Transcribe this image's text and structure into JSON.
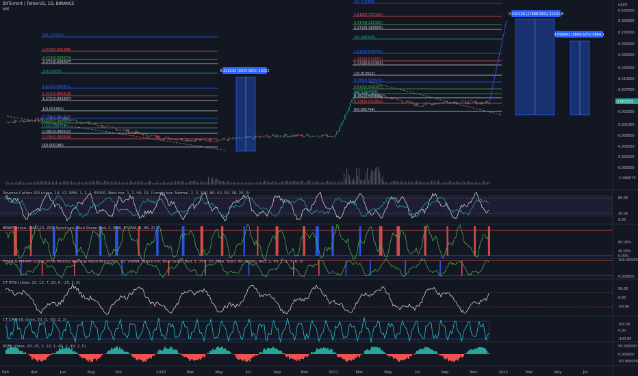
{
  "header": {
    "symbol": "BitTorrent / TetherUS, 1D, BINANCE",
    "vol": "Vol"
  },
  "colors": {
    "bg": "#131722",
    "up": "#26a69a",
    "down": "#ef5350",
    "fibBlue": "#2962ff",
    "grid": "#2a2e39",
    "axisText": "#b2b5be",
    "white": "#d1d4dc"
  },
  "price_axis": {
    "unit": "USDT",
    "ticks": [
      "0.550000",
      "0.300000",
      "0.150000",
      "0.090000",
      "0.050000",
      "0.025000",
      "0.013000",
      "0.007000",
      "0.004000",
      "0.002000",
      "0.001000",
      "0.000500",
      "0.000250",
      "0.000100",
      "0.000000",
      "-0.000070"
    ],
    "current_price": "0.003523"
  },
  "time_axis": [
    "Feb",
    "Apr",
    "Jun",
    "Aug",
    "Oct",
    "2020",
    "Mar",
    "May",
    "Jul",
    "Sep",
    "Nov",
    "2021",
    "Mar",
    "May",
    "Jul",
    "Sep",
    "Nov",
    "2022",
    "Mar",
    "May",
    "Jul"
  ],
  "fib_left": [
    {
      "label": "3(0.113421)",
      "color": "#2962ff"
    },
    {
      "label": "2.618(0.052396)",
      "color": "#ef5350"
    },
    {
      "label": "2.414(0.034674)",
      "color": "#4caf50"
    },
    {
      "label": "2.272(0.026007)",
      "color": "#d1d4dc"
    },
    {
      "label": "2(0.01975)",
      "color": "#26a69a"
    },
    {
      "label": "1.618(0.006471)",
      "color": "#2962ff"
    },
    {
      "label": "1.414(0.004518)",
      "color": "#ef5350"
    },
    {
      "label": "1.272(0.003367)",
      "color": "#d1d4dc"
    },
    {
      "label": "1(0.001902)",
      "color": "#d1d4dc"
    },
    {
      "label": "0.786(0.001303)",
      "color": "#2962ff"
    },
    {
      "label": "0.618(0.000932)",
      "color": "#4caf50"
    },
    {
      "label": "0.5(0.000711)",
      "color": "#26a69a"
    },
    {
      "label": "0.382(0.000532)",
      "color": "#d1d4dc"
    },
    {
      "label": "0.236(0.000328)",
      "color": "#ef5350"
    },
    {
      "label": "0(0.000166)",
      "color": "#d1d4dc"
    }
  ],
  "fib_right": [
    {
      "label": "3(0.718399)",
      "color": "#2962ff"
    },
    {
      "label": "2.618(0.337193)",
      "color": "#ef5350"
    },
    {
      "label": "2.414(0.225150)",
      "color": "#4caf50"
    },
    {
      "label": "2.272(0.169956)",
      "color": "#d1d4dc"
    },
    {
      "label": "2(0.099158)",
      "color": "#26a69a"
    },
    {
      "label": "1.618(0.046499)",
      "color": "#2962ff"
    },
    {
      "label": "1.414(0.031097)",
      "color": "#ef5350"
    },
    {
      "label": "1.272(0.023393)",
      "color": "#d1d4dc"
    },
    {
      "label": "1(0.013612)",
      "color": "#d1d4dc"
    },
    {
      "label": "0.786(0.008916)",
      "color": "#2962ff"
    },
    {
      "label": "0.618(0.006387)",
      "color": "#4caf50"
    },
    {
      "label": "0.5(0.004966)",
      "color": "#26a69a"
    },
    {
      "label": "0.382(0.003835)",
      "color": "#d1d4dc"
    },
    {
      "label": "0.236(0.002902)",
      "color": "#ef5350"
    },
    {
      "label": "0(0.001794)",
      "color": "#d1d4dc"
    }
  ],
  "measure_boxes": [
    {
      "label": "0.212232 (8215.61%) 13212"
    },
    {
      "label": "0.315218 (17908.56%) 31521.8"
    },
    {
      "label": "0.098641 (5604.62%) 9864.1"
    }
  ],
  "panels": [
    {
      "label": "Reverse Cutlers RSI (close, 14, 12, SMA, 1, 2, 1, 65000, Next bar, 1, 1, 90, 15, Current bar, Normal, 2, 3, 100, 80, 62, 50, 38, 20, 0)",
      "ticks": [
        "80.00",
        "20.00",
        "0.00"
      ]
    },
    {
      "label": "BBWP (close, SMA, 13, 252, Spectrum, Blue Green Red, 2, SMA, 5, SMA, 8, 98, 2)",
      "ticks": [
        "80.00%",
        "40.00%",
        "0.00%"
      ]
    },
    {
      "label": "PMAR & PMARP (close, Price Moving Average Ratio Percentile, 20, VWMA, Spectrum, Blue Green Red, 1, 350, 20, SMA, Solid, 80, Green, Red, 1, 99, 1, 2, 7, 6, 5)",
      "ticks": [
        "100.000000",
        "0.000000"
      ]
    },
    {
      "label": "CT RTSI (close, 25, 13, 7, 25, 0, -25, 2, 6)",
      "ticks": [
        "50.00",
        "0.00",
        "-50.00"
      ]
    },
    {
      "label": "CT CMO (9, close, 50, 0, -50, 2, 3)",
      "ticks": [
        "100.00",
        "0.00",
        "-100.00"
      ]
    },
    {
      "label": "RSMI (close, 13, 25, 2, 12, 1, 40, 2, 40, 2, 5)",
      "ticks": [
        "50.000000",
        "0.000000",
        "-50.000000"
      ]
    }
  ],
  "chart_data": {
    "type": "line",
    "title": "BitTorrent / TetherUS, 1D, BINANCE",
    "y_scale": "log",
    "ylabel": "USDT",
    "x": [
      "2019-02",
      "2019-04",
      "2019-06",
      "2019-08",
      "2019-10",
      "2020-01",
      "2020-03",
      "2020-05",
      "2020-07",
      "2020-09",
      "2020-11",
      "2021-01",
      "2021-03",
      "2021-05",
      "2021-07",
      "2021-09",
      "2021-11"
    ],
    "series": [
      {
        "values": [
          0.001,
          0.0011,
          0.0013,
          0.0009,
          0.0006,
          0.00035,
          0.0003,
          0.0003,
          0.00034,
          0.0004,
          0.0004,
          0.0004,
          0.007,
          0.005,
          0.003,
          0.0038,
          0.00352
        ]
      }
    ],
    "grid": false,
    "legend": "none"
  }
}
